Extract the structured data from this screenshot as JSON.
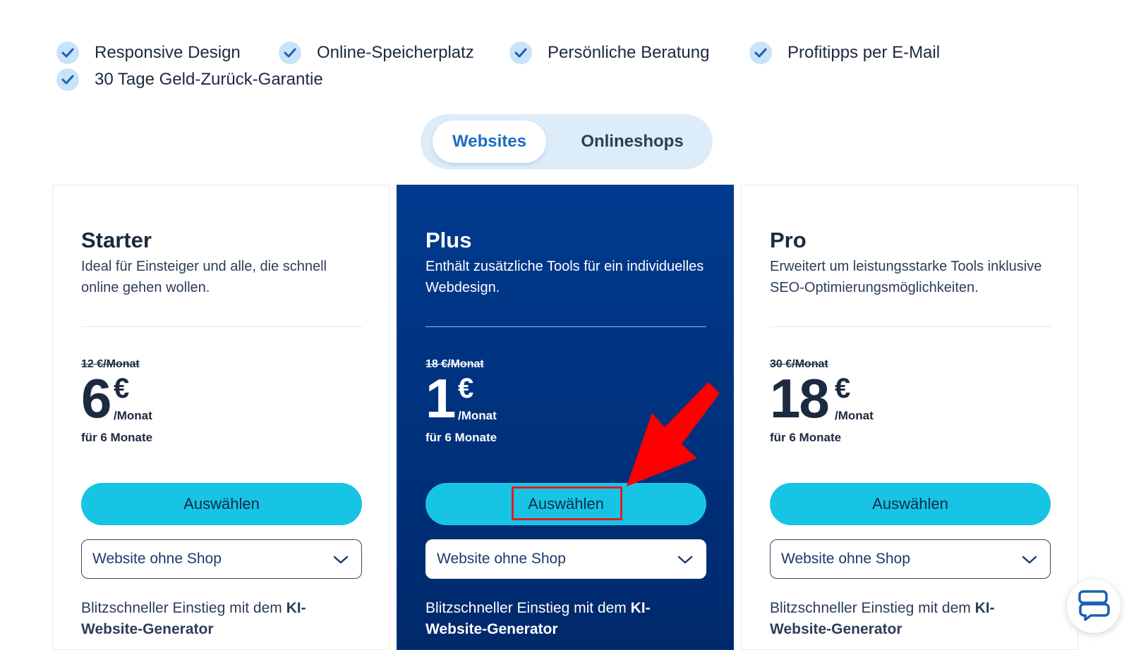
{
  "features": [
    {
      "label": "Responsive Design"
    },
    {
      "label": "Online-Speicherplatz"
    },
    {
      "label": "Persönliche Beratung"
    },
    {
      "label": "Profitipps per E-Mail"
    },
    {
      "label": "30 Tage Geld-Zurück-Garantie"
    }
  ],
  "tabs": [
    {
      "label": "Websites",
      "active": true
    },
    {
      "label": "Onlineshops",
      "active": false
    }
  ],
  "plans": [
    {
      "name": "Starter",
      "description": "Ideal für Einsteiger und alle, die schnell online gehen wollen.",
      "old_price": "12 €/Monat",
      "price": "6",
      "currency": "€",
      "unit": "/Monat",
      "duration": "für 6 Monate",
      "button": "Auswählen",
      "dropdown": "Website ohne Shop",
      "promo_text": "Blitzschneller Einstieg mit dem ",
      "promo_bold": "KI-Website-Generator",
      "featured": false
    },
    {
      "name": "Plus",
      "description": "Enthält zusätzliche Tools für ein individuelles Webdesign.",
      "old_price": "18 €/Monat",
      "price": "1",
      "currency": "€",
      "unit": "/Monat",
      "duration": "für 6 Monate",
      "button": "Auswählen",
      "dropdown": "Website ohne Shop",
      "promo_text": "Blitzschneller Einstieg mit dem ",
      "promo_bold": "KI-Website-Generator",
      "featured": true
    },
    {
      "name": "Pro",
      "description": "Erweitert um leistungsstarke Tools inklusive SEO-Optimierungsmöglichkeiten.",
      "old_price": "30 €/Monat",
      "price": "18",
      "currency": "€",
      "unit": "/Monat",
      "duration": "für 6 Monate",
      "button": "Auswählen",
      "dropdown": "Website ohne Shop",
      "promo_text": "Blitzschneller Einstieg mit dem ",
      "promo_bold": "KI-Website-Generator",
      "featured": false
    }
  ],
  "colors": {
    "accent": "#17c4e4",
    "featured_bg": "#003b8f",
    "tab_active_text": "#1a6fc0",
    "annotation": "#e31b23"
  },
  "icons": {
    "feature": "check-icon",
    "dropdown": "chevron-down-icon",
    "chat": "chat-bubbles-icon",
    "annotation": "red-arrow-icon"
  }
}
